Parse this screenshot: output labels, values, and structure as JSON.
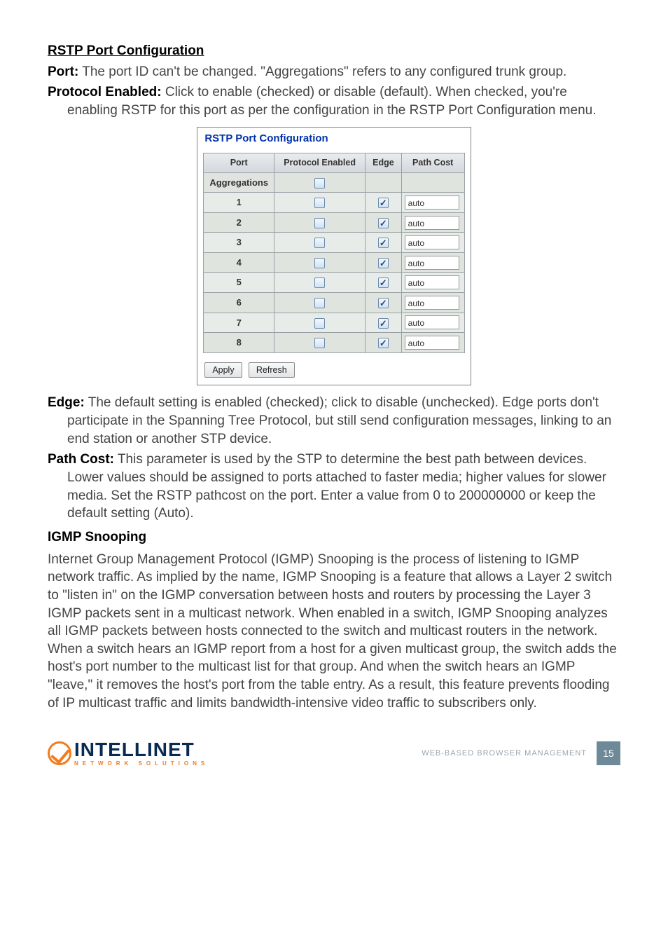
{
  "sections": {
    "rstp_title": "RSTP Port Configuration",
    "port_label": "Port:",
    "port_text": " The port ID can't be changed. \"Aggregations\" refers to any configured trunk group.",
    "proto_label": "Protocol Enabled:",
    "proto_text": " Click to enable (checked) or disable (default). When checked, you're enabling RSTP for this port as per the configuration in the RSTP Port Configuration menu.",
    "edge_label": "Edge:",
    "edge_text": " The default setting is enabled (checked); click to disable (unchecked). Edge ports don't participate in the Spanning Tree Protocol, but still send configuration messages, linking to an end station or another STP device.",
    "pathcost_label": "Path Cost:",
    "pathcost_text": " This parameter is used by the STP to determine the best path between devices. Lower values should be assigned to ports attached to faster media; higher values for slower media. Set the RSTP pathcost on the port. Enter a value from 0 to 200000000 or keep the default setting (Auto).",
    "igmp_title": "IGMP Snooping",
    "igmp_body": "Internet Group Management Protocol (IGMP) Snooping is the process of listening to IGMP network traffic. As implied by the name, IGMP Snooping is a feature that allows a Layer 2 switch to \"listen in\" on the IGMP conversation between hosts and routers by processing the Layer 3 IGMP packets sent in a multicast network. When enabled in a switch, IGMP Snooping analyzes all IGMP packets between hosts connected to the switch and multicast routers in the network. When a switch hears an IGMP report from a host for a given multicast group, the switch adds the host's port number to the multicast list for that group. And when the switch hears an IGMP \"leave,\" it removes the host's port from the table entry. As a result, this feature prevents flooding of IP multicast traffic and limits bandwidth-intensive video traffic to subscribers only."
  },
  "panel": {
    "title": "RSTP Port Configuration",
    "headers": {
      "port": "Port",
      "proto": "Protocol Enabled",
      "edge": "Edge",
      "path": "Path Cost"
    },
    "agg_label": "Aggregations",
    "rows": [
      {
        "port": "1",
        "proto": false,
        "edge": true,
        "path": "auto"
      },
      {
        "port": "2",
        "proto": false,
        "edge": true,
        "path": "auto"
      },
      {
        "port": "3",
        "proto": false,
        "edge": true,
        "path": "auto"
      },
      {
        "port": "4",
        "proto": false,
        "edge": true,
        "path": "auto"
      },
      {
        "port": "5",
        "proto": false,
        "edge": true,
        "path": "auto"
      },
      {
        "port": "6",
        "proto": false,
        "edge": true,
        "path": "auto"
      },
      {
        "port": "7",
        "proto": false,
        "edge": true,
        "path": "auto"
      },
      {
        "port": "8",
        "proto": false,
        "edge": true,
        "path": "auto"
      }
    ],
    "buttons": {
      "apply": "Apply",
      "refresh": "Refresh"
    }
  },
  "footer": {
    "brand": "INTELLINET",
    "brand_sub": "NETWORK SOLUTIONS",
    "section_label": "WEB-BASED BROWSER MANAGEMENT",
    "page": "15"
  }
}
